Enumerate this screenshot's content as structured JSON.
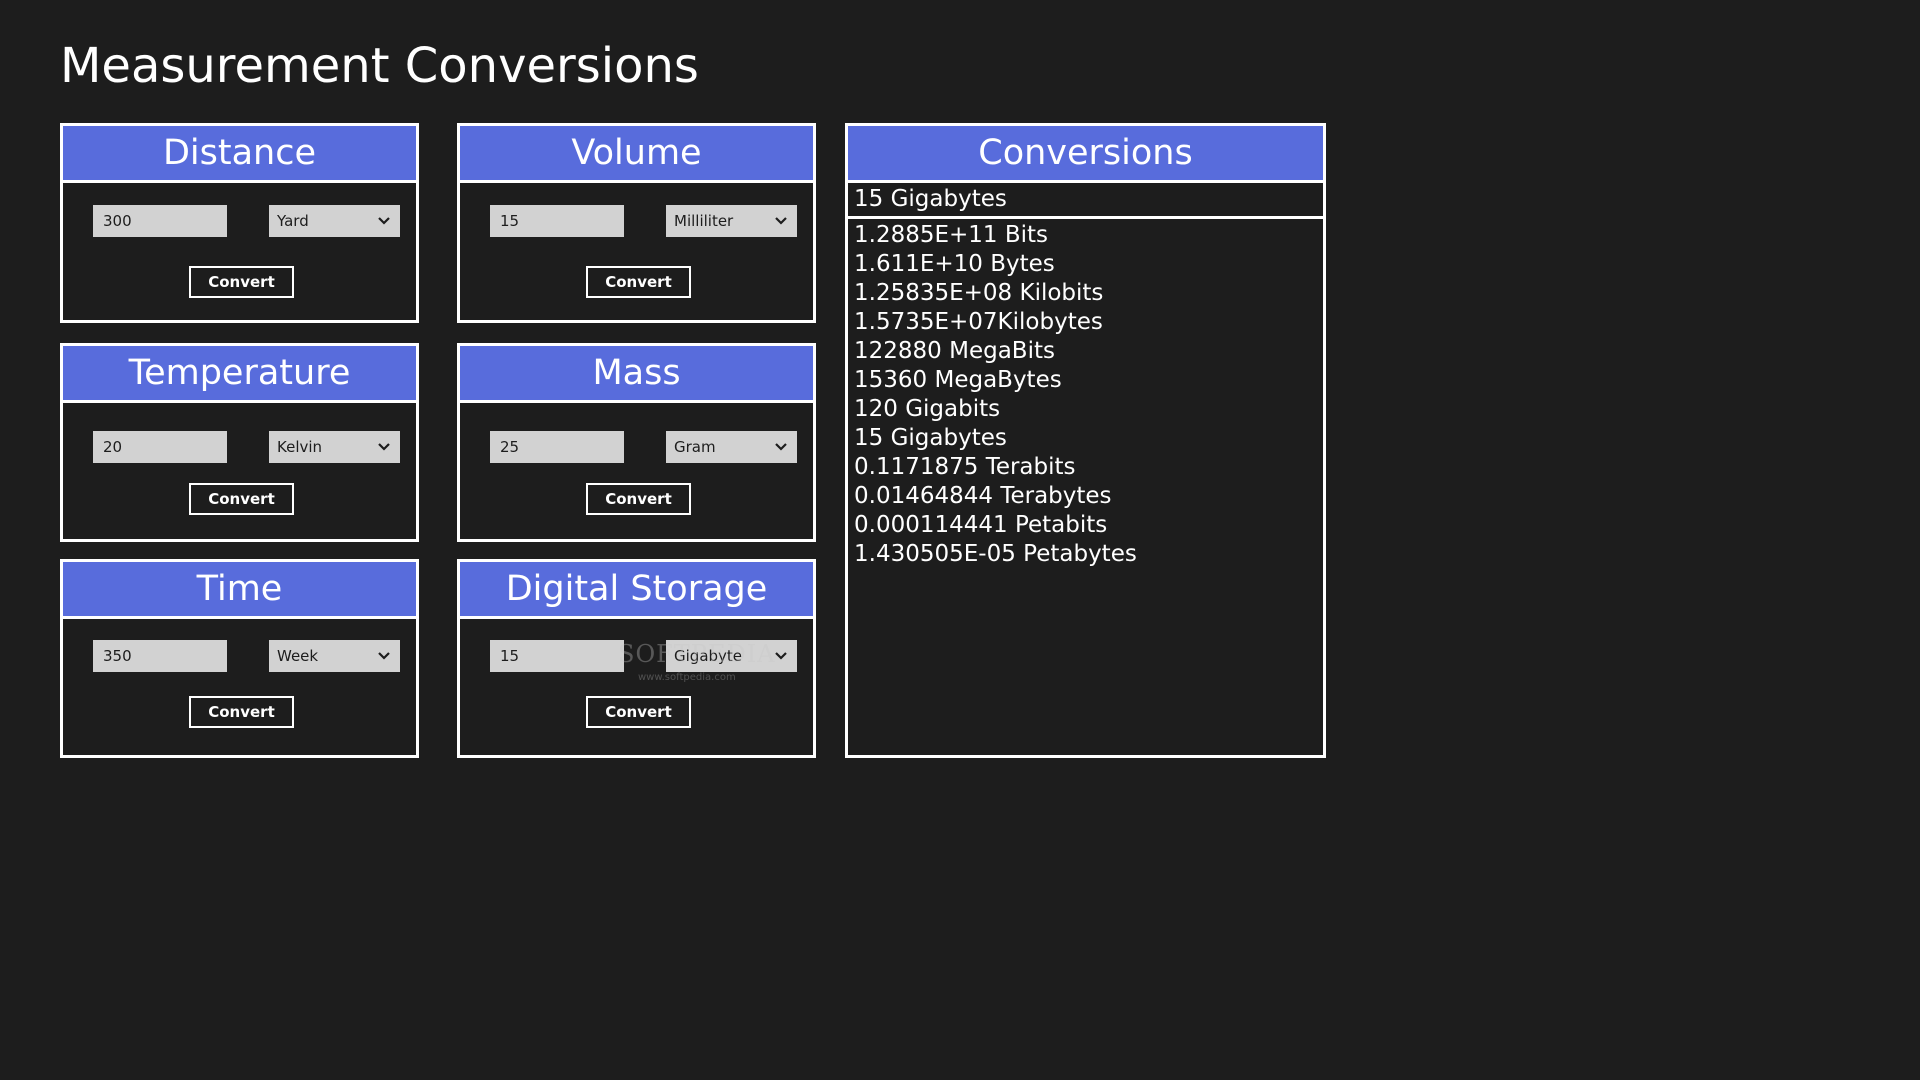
{
  "app": {
    "title": "Measurement Conversions"
  },
  "colors": {
    "background": "#1d1d1d",
    "header_accent": "#586cdc",
    "border": "#ffffff",
    "input_fill": "#d2d2d2"
  },
  "icons": {
    "dropdown": "chevron-down-icon"
  },
  "cards": {
    "distance": {
      "title": "Distance",
      "value": "300",
      "unit": "Yard",
      "button": "Convert"
    },
    "volume": {
      "title": "Volume",
      "value": "15",
      "unit": "Milliliter",
      "button": "Convert"
    },
    "temperature": {
      "title": "Temperature",
      "value": "20",
      "unit": "Kelvin",
      "button": "Convert"
    },
    "mass": {
      "title": "Mass",
      "value": "25",
      "unit": "Gram",
      "button": "Convert"
    },
    "time": {
      "title": "Time",
      "value": "350",
      "unit": "Week",
      "button": "Convert"
    },
    "digital_storage": {
      "title": "Digital Storage",
      "value": "15",
      "unit": "Gigabyte",
      "button": "Convert"
    }
  },
  "conversions": {
    "title": "Conversions",
    "selected": "15 Gigabytes",
    "results": [
      "1.2885E+11 Bits",
      "1.611E+10 Bytes",
      "1.25835E+08 Kilobits",
      "1.5735E+07Kilobytes",
      "122880 MegaBits",
      "15360 MegaBytes",
      "120 Gigabits",
      "15 Gigabytes",
      "0.1171875 Terabits",
      "0.01464844 Terabytes",
      "0.000114441 Petabits",
      "1.430505E-05 Petabytes"
    ]
  },
  "watermark": {
    "text": "SOFTPEDIA",
    "url": "www.softpedia.com"
  }
}
